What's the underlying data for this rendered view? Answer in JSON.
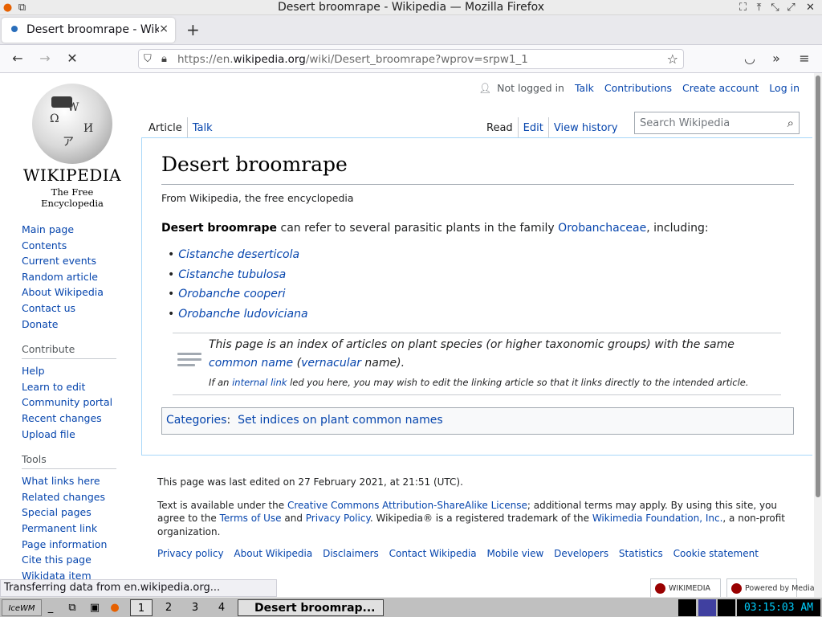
{
  "window": {
    "title": "Desert broomrape - Wikipedia — Mozilla Firefox"
  },
  "browser": {
    "tab_title": "Desert broomrape - Wikipedia",
    "tab_close": "×",
    "new_tab": "+",
    "url_host": "https://en.",
    "url_domain": "wikipedia.org",
    "url_path": "/wiki/Desert_broomrape?wprov=srpw1_1",
    "status_text": "Transferring data from en.wikipedia.org..."
  },
  "logo": {
    "wordmark": "WIKIPEDIA",
    "tagline": "The Free Encyclopedia"
  },
  "sidebar": {
    "navigation": [
      "Main page",
      "Contents",
      "Current events",
      "Random article",
      "About Wikipedia",
      "Contact us",
      "Donate"
    ],
    "contribute_heading": "Contribute",
    "contribute": [
      "Help",
      "Learn to edit",
      "Community portal",
      "Recent changes",
      "Upload file"
    ],
    "tools_heading": "Tools",
    "tools": [
      "What links here",
      "Related changes",
      "Special pages",
      "Permanent link",
      "Page information",
      "Cite this page",
      "Wikidata item"
    ]
  },
  "personal": {
    "not_logged_in": "Not logged in",
    "talk": "Talk",
    "contributions": "Contributions",
    "create_account": "Create account",
    "log_in": "Log in"
  },
  "tabs": {
    "article": "Article",
    "talk": "Talk",
    "read": "Read",
    "edit": "Edit",
    "view_history": "View history"
  },
  "search": {
    "placeholder": "Search Wikipedia"
  },
  "article": {
    "heading": "Desert broomrape",
    "tagline": "From Wikipedia, the free encyclopedia",
    "lead_bold": "Desert broomrape",
    "lead_text": " can refer to several parasitic plants in the family ",
    "lead_link": "Orobanchaceae",
    "lead_end": ", including:",
    "items": [
      "Cistanche deserticola",
      "Cistanche tubulosa",
      "Orobanche cooperi",
      "Orobanche ludoviciana"
    ],
    "setindex": {
      "line1": "This page is an index of articles on plant species (or higher taxonomic groups) with the same",
      "line2_link1": "common name",
      "line2_mid1": " (",
      "line2_link2": "vernacular",
      "line2_end": " name).",
      "line3_start": "If an ",
      "line3_link": "internal link",
      "line3_end": " led you here, you may wish to edit the linking article so that it links directly to the intended article."
    },
    "categories_label": "Categories",
    "categories_sep": ":",
    "category": "Set indices on plant common names"
  },
  "footer": {
    "last_edited": "This page was last edited on 27 February 2021, at 21:51 (UTC).",
    "license_start": "Text is available under the ",
    "license_link": "Creative Commons Attribution-ShareAlike License",
    "license_mid": "; additional terms may apply. By using this site, you agree to the ",
    "terms_link": "Terms of Use",
    "and": " and ",
    "privacy_link": "Privacy Policy",
    "trademark": ". Wikipedia® is a registered trademark of the ",
    "foundation_link": "Wikimedia Foundation, Inc.",
    "nonprofit": ", a non-profit organization.",
    "links": [
      "Privacy policy",
      "About Wikipedia",
      "Disclaimers",
      "Contact Wikipedia",
      "Mobile view",
      "Developers",
      "Statistics",
      "Cookie statement"
    ],
    "badge_wikimedia": "WIKIMEDIA",
    "badge_mediawiki": "Powered by MediaWiki"
  },
  "taskbar": {
    "workspaces": [
      "1",
      "2",
      "3",
      "4"
    ],
    "window_title": "Desert broomrap...",
    "clock": "03:15:03 AM"
  },
  "colors": {
    "link": "#0645ad",
    "content_border": "#a7d7f9",
    "clock_text": "#00d0ff"
  }
}
